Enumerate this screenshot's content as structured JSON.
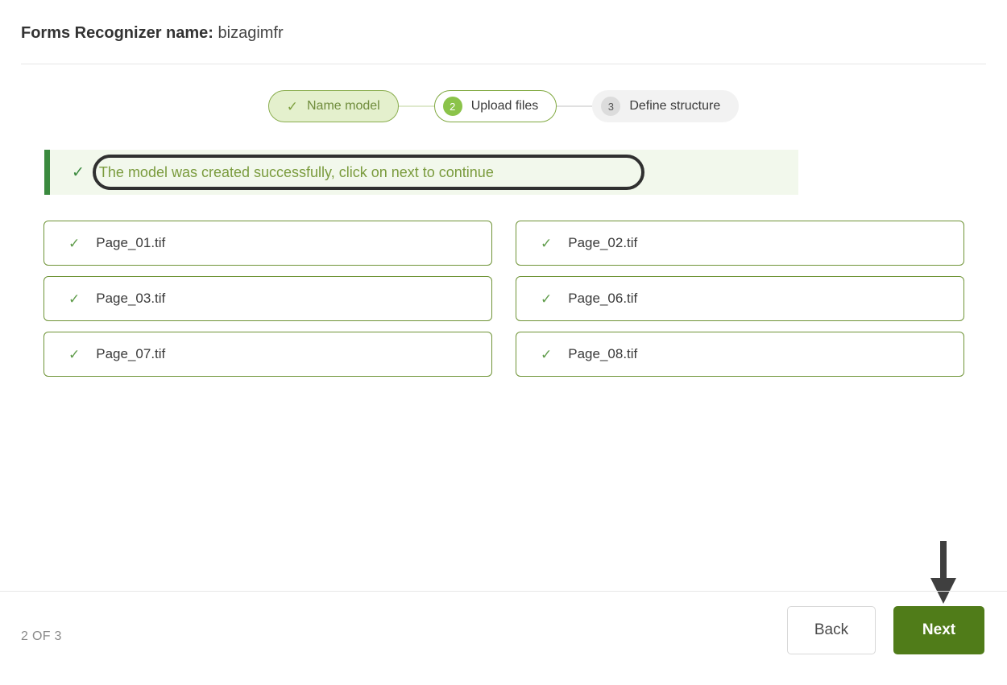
{
  "header": {
    "label": "Forms Recognizer name:",
    "value": "bizagimfr"
  },
  "stepper": {
    "steps": [
      {
        "id": "name-model",
        "label": "Name model",
        "marker": "✓",
        "state": "done"
      },
      {
        "id": "upload-files",
        "label": "Upload files",
        "marker": "2",
        "state": "current"
      },
      {
        "id": "define-structure",
        "label": "Define structure",
        "marker": "3",
        "state": "upcoming"
      }
    ]
  },
  "banner": {
    "icon": "✓",
    "message": "The model was created successfully, click on next to continue",
    "accent_color": "#3b8a3f",
    "background_color": "#f2f8ec",
    "text_color": "#7a9b3d"
  },
  "files": [
    {
      "name": "Page_01.tif",
      "check": "✓"
    },
    {
      "name": "Page_02.tif",
      "check": "✓"
    },
    {
      "name": "Page_03.tif",
      "check": "✓"
    },
    {
      "name": "Page_06.tif",
      "check": "✓"
    },
    {
      "name": "Page_07.tif",
      "check": "✓"
    },
    {
      "name": "Page_08.tif",
      "check": "✓"
    }
  ],
  "footer": {
    "page_indicator": "2 OF 3",
    "back_label": "Back",
    "next_label": "Next",
    "next_color": "#507c19"
  },
  "annotations": {
    "oval_color": "#303030",
    "arrow_color": "#3f3f3f"
  }
}
